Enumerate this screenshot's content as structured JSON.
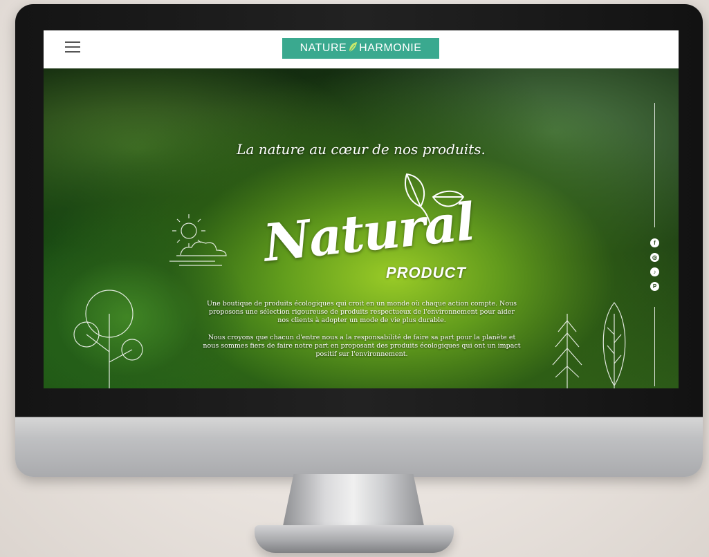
{
  "header": {
    "menu_icon": "hamburger-menu-icon",
    "logo_left": "NATURE",
    "logo_right": "HARMONIE"
  },
  "hero": {
    "tagline": "La nature au cœur de nos produits.",
    "brand_word": "Natural",
    "brand_sub": "PRODUCT",
    "paragraph1": "Une boutique de produits écologiques qui croit en un monde où chaque action compte. Nous proposons une sélection rigoureuse de produits respectueux de l'environnement pour aider nos clients à adopter un mode de vie plus durable.",
    "paragraph2": "Nous croyons que chacun d'entre nous a la responsabilité de faire sa part pour la planète et nous sommes fiers de faire notre part en proposant des produits écologiques qui ont un impact positif sur l'environnement."
  },
  "social": [
    {
      "name": "facebook-icon",
      "glyph": "f"
    },
    {
      "name": "instagram-icon",
      "glyph": "◎"
    },
    {
      "name": "tiktok-icon",
      "glyph": "♪"
    },
    {
      "name": "pinterest-icon",
      "glyph": "P"
    }
  ],
  "colors": {
    "logo_bg": "#3aa98f",
    "topbar_bg": "#ffffff",
    "text": "#ffffff"
  }
}
